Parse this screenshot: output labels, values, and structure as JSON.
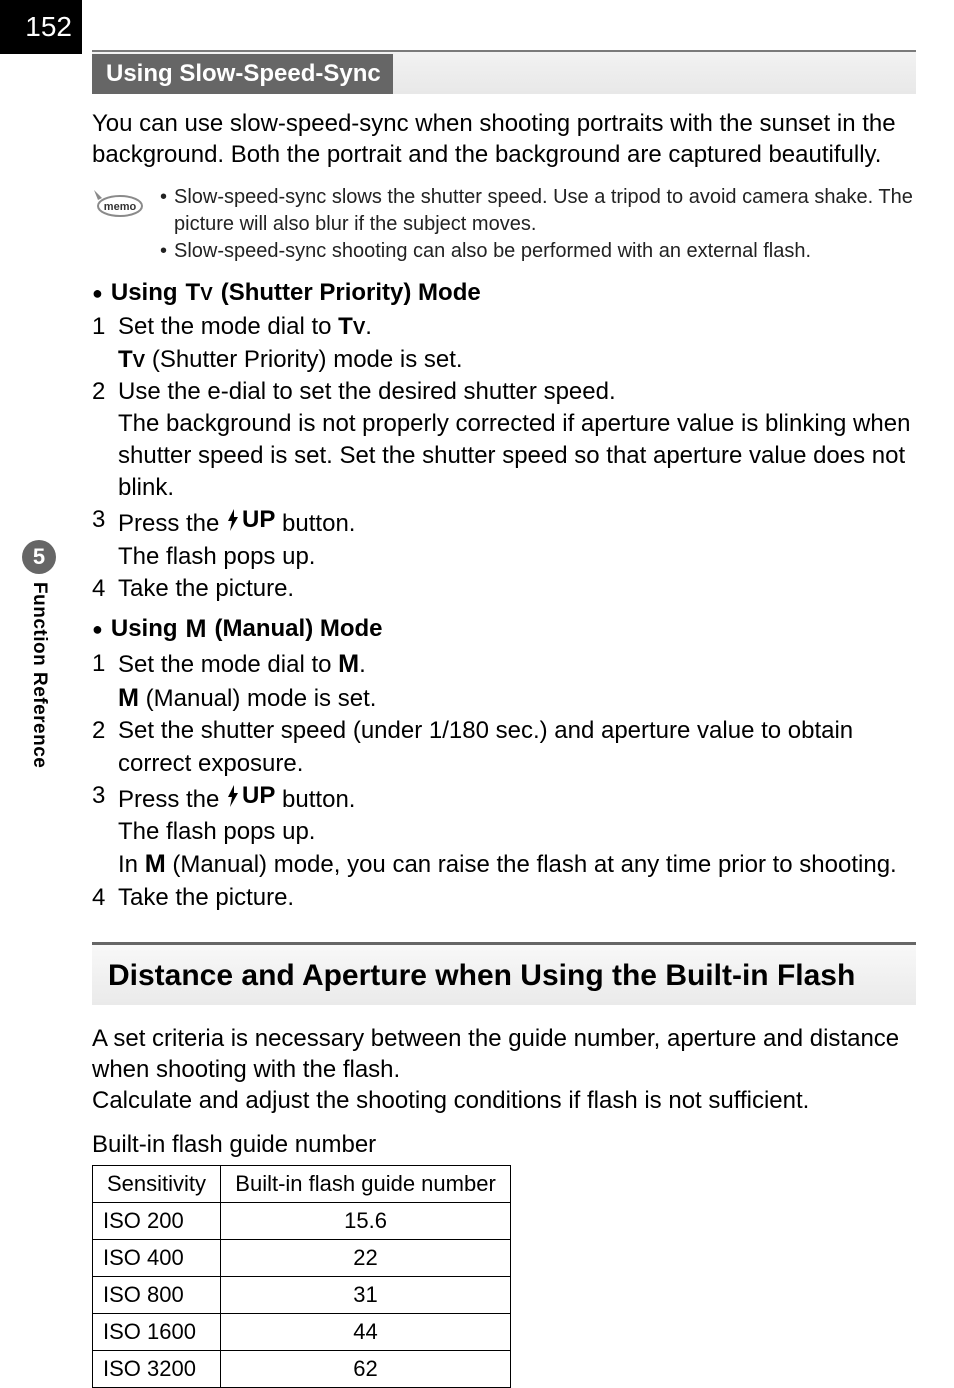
{
  "page_number": "152",
  "side_tab": {
    "number": "5",
    "label": "Function Reference"
  },
  "subhead1": "Using Slow-Speed-Sync",
  "intro_p": "You can use slow-speed-sync when shooting portraits with the sunset in the background. Both the portrait and the background are captured beautifully.",
  "memo": {
    "items": [
      "Slow-speed-sync slows the shutter speed. Use a tripod to avoid camera shake. The picture will also blur if the subject moves.",
      "Slow-speed-sync shooting can also be performed with an external flash."
    ]
  },
  "h3_tv_prefix": "Using ",
  "h3_tv_suffix": " (Shutter Priority) Mode",
  "tv_steps": [
    {
      "n": "1",
      "lines": [
        "Set the mode dial to ",
        "."
      ],
      "after": " (Shutter Priority) mode is set."
    },
    {
      "n": "2",
      "text": "Use the e-dial to set the desired shutter speed.",
      "after": "The background is not properly corrected if aperture value is blinking when shutter speed is set. Set the shutter speed so that aperture value does not blink."
    },
    {
      "n": "3",
      "press_prefix": "Press the ",
      "press_suffix": " button.",
      "after": "The flash pops up."
    },
    {
      "n": "4",
      "text": "Take the picture."
    }
  ],
  "h3_m_prefix": "Using ",
  "h3_m_suffix": " (Manual) Mode",
  "m_steps": [
    {
      "n": "1",
      "lines": [
        "Set the mode dial to ",
        "."
      ],
      "after": " (Manual) mode is set."
    },
    {
      "n": "2",
      "text": "Set the shutter speed (under 1/180 sec.) and aperture value to obtain correct exposure."
    },
    {
      "n": "3",
      "press_prefix": "Press the ",
      "press_suffix": " button.",
      "after1": "The flash pops up.",
      "after2_prefix": "In ",
      "after2_suffix": " (Manual) mode, you can raise the flash at any time prior to shooting."
    },
    {
      "n": "4",
      "text": "Take the picture."
    }
  ],
  "section2_title": "Distance and Aperture when Using the Built-in Flash",
  "section2_p": "A set criteria is necessary between the guide number, aperture and distance when shooting with the flash.\nCalculate and adjust the shooting conditions if flash is not sufficient.",
  "table_title": "Built-in flash guide number",
  "table": {
    "headers": [
      "Sensitivity",
      "Built-in flash guide number"
    ],
    "rows": [
      [
        "ISO 200",
        "15.6"
      ],
      [
        "ISO 400",
        "22"
      ],
      [
        "ISO 800",
        "31"
      ],
      [
        "ISO 1600",
        "44"
      ],
      [
        "ISO 3200",
        "62"
      ]
    ]
  },
  "flash_up_label": "UP",
  "memo_label": "memo",
  "chart_data": {
    "type": "table",
    "title": "Built-in flash guide number",
    "columns": [
      "Sensitivity",
      "Built-in flash guide number"
    ],
    "rows": [
      {
        "Sensitivity": "ISO 200",
        "Built-in flash guide number": 15.6
      },
      {
        "Sensitivity": "ISO 400",
        "Built-in flash guide number": 22
      },
      {
        "Sensitivity": "ISO 800",
        "Built-in flash guide number": 31
      },
      {
        "Sensitivity": "ISO 1600",
        "Built-in flash guide number": 44
      },
      {
        "Sensitivity": "ISO 3200",
        "Built-in flash guide number": 62
      }
    ]
  }
}
